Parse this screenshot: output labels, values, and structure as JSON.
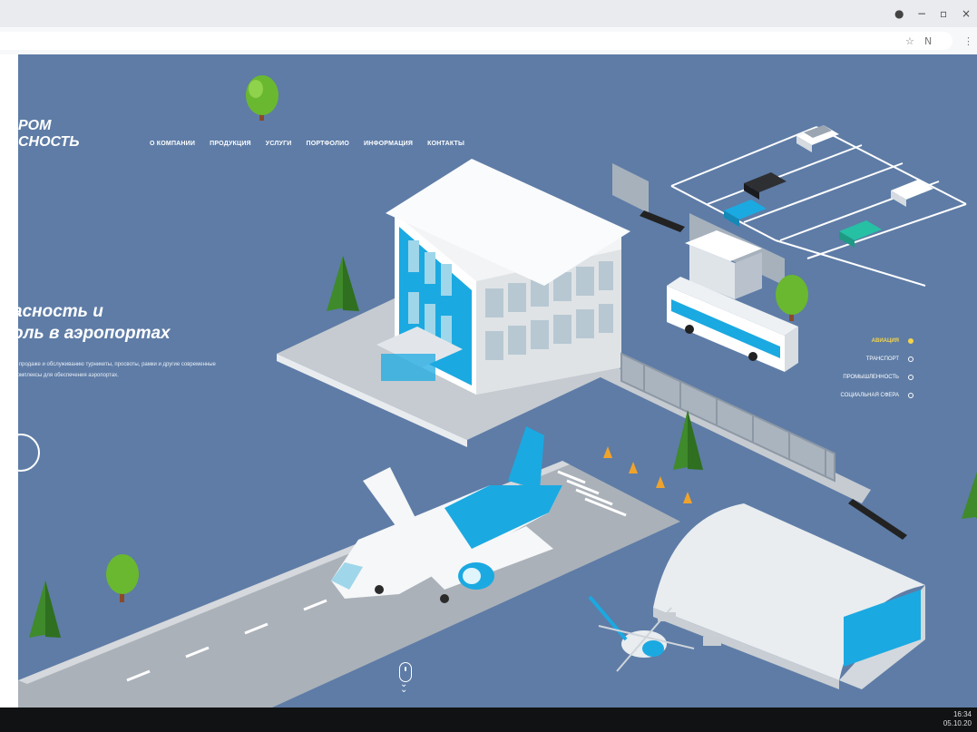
{
  "browser": {
    "window_controls": [
      "−",
      "▫",
      "×"
    ],
    "addr_icons": [
      "☆",
      "N",
      "⋮"
    ]
  },
  "site": {
    "logo_line1": "РОМ",
    "logo_line2": "СНОСТЬ",
    "nav": [
      "О КОМПАНИИ",
      "ПРОДУКЦИЯ",
      "УСЛУГИ",
      "ПОРТФОЛИО",
      "ИНФОРМАЦИЯ",
      "КОНТАКТЫ"
    ],
    "hero_title_line1": "асность и",
    "hero_title_line2": "оль в аэропортах",
    "hero_text": "в продаже и обслуживанию турникеты, просвоты, рамки и другие современные комплексы для обеспечения аэропортах.",
    "categories": [
      {
        "label": "АВИАЦИЯ",
        "active": true
      },
      {
        "label": "ТРАНСПОРТ",
        "active": false
      },
      {
        "label": "ПРОМЫШЛЕННОСТЬ",
        "active": false
      },
      {
        "label": "СОЦИАЛЬНАЯ СФЕРА",
        "active": false
      }
    ]
  },
  "taskbar": {
    "time": "16:34",
    "date": "05.10.20"
  },
  "colors": {
    "page_bg": "#5e7ca6",
    "accent_blue": "#1ba9e1",
    "active_category": "#f5d44a"
  }
}
